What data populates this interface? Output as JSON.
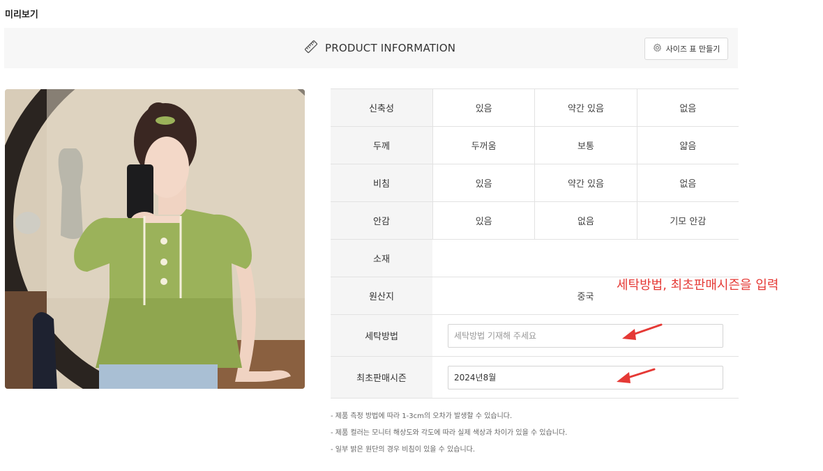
{
  "page": {
    "preview_label": "미리보기"
  },
  "header": {
    "title": "PRODUCT INFORMATION",
    "icon": "ruler-icon",
    "size_table_button": {
      "label": "사이즈 표 만들기",
      "icon": "gear-icon"
    }
  },
  "product_image": {
    "description_icon": "product-photo"
  },
  "table": {
    "rows": [
      {
        "label": "신축성",
        "cells": [
          "있음",
          "약간 있음",
          "없음"
        ]
      },
      {
        "label": "두께",
        "cells": [
          "두꺼움",
          "보통",
          "얇음"
        ]
      },
      {
        "label": "비침",
        "cells": [
          "있음",
          "약간 있음",
          "없음"
        ]
      },
      {
        "label": "안감",
        "cells": [
          "있음",
          "없음",
          "기모 안감"
        ]
      },
      {
        "label": "소재",
        "value": ""
      },
      {
        "label": "원산지",
        "value": "중국"
      }
    ],
    "washing": {
      "label": "세탁방법",
      "value": "",
      "placeholder": "세탁방법 기재해 주세요"
    },
    "first_sale": {
      "label": "최초판매시즌",
      "value": "2024년8월",
      "placeholder": ""
    }
  },
  "notes": [
    "- 제품 측정 방법에 따라 1-3cm의 오차가 발생할 수 있습니다.",
    "- 제품 컬러는 모니터 해상도와 각도에 따라 실제 색상과 차이가 있을 수 있습니다.",
    "- 일부 밝은 원단의 경우 비침이 있을 수 있습니다."
  ],
  "annotation": {
    "text": "세탁방법, 최초판매시즌을 입력",
    "color": "#e53935"
  },
  "colors": {
    "header_bg": "#f7f7f7",
    "label_bg": "#f5f5f5",
    "border": "#e2e2e2",
    "accent_red": "#e53935"
  }
}
